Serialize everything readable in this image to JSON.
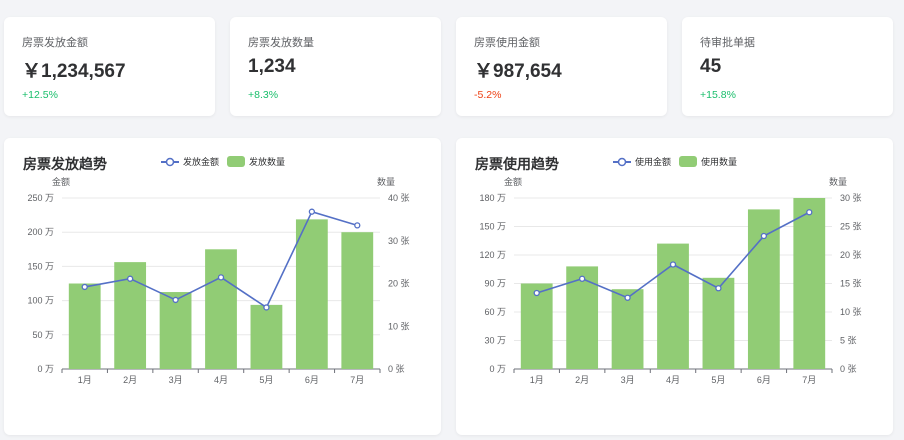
{
  "stats": [
    {
      "label": "房票发放金额",
      "value": "￥1,234,567",
      "change": "+12.5%",
      "change_color": "#19be6b"
    },
    {
      "label": "房票发放数量",
      "value": "1,234",
      "change": "+8.3%",
      "change_color": "#19be6b"
    },
    {
      "label": "房票使用金额",
      "value": "￥987,654",
      "change": "-5.2%",
      "change_color": "#ed4014"
    },
    {
      "label": "待审批单据",
      "value": "45",
      "change": "+15.8%",
      "change_color": "#19be6b"
    }
  ],
  "colors": {
    "bar": "#91cc75",
    "line": "#5470c6"
  },
  "chart_data": [
    {
      "type": "bar",
      "title": "房票发放趋势",
      "categories": [
        "1月",
        "2月",
        "3月",
        "4月",
        "5月",
        "6月",
        "7月"
      ],
      "series": [
        {
          "name": "发放金额",
          "type": "line",
          "axis": "left",
          "values": [
            120,
            132,
            101,
            134,
            90,
            230,
            210
          ]
        },
        {
          "name": "发放数量",
          "type": "bar",
          "axis": "right",
          "values": [
            20,
            25,
            18,
            28,
            15,
            35,
            32
          ]
        }
      ],
      "ylabel_left": "金额",
      "ylabel_right": "数量",
      "ylim_left": [
        0,
        250
      ],
      "ylim_right": [
        0,
        40
      ],
      "yticks_left": [
        "0 万",
        "50 万",
        "100 万",
        "150 万",
        "200 万",
        "250 万"
      ],
      "yticks_right": [
        "0 张",
        "10 张",
        "20 张",
        "30 张",
        "40 张"
      ]
    },
    {
      "type": "bar",
      "title": "房票使用趋势",
      "categories": [
        "1月",
        "2月",
        "3月",
        "4月",
        "5月",
        "6月",
        "7月"
      ],
      "series": [
        {
          "name": "使用金额",
          "type": "line",
          "axis": "left",
          "values": [
            80,
            95,
            75,
            110,
            85,
            140,
            165
          ]
        },
        {
          "name": "使用数量",
          "type": "bar",
          "axis": "right",
          "values": [
            15,
            18,
            14,
            22,
            16,
            28,
            30
          ]
        }
      ],
      "ylabel_left": "金额",
      "ylabel_right": "数量",
      "ylim_left": [
        0,
        180
      ],
      "ylim_right": [
        0,
        30
      ],
      "yticks_left": [
        "0 万",
        "30 万",
        "60 万",
        "90 万",
        "120 万",
        "150 万",
        "180 万"
      ],
      "yticks_right": [
        "0 张",
        "5 张",
        "10 张",
        "15 张",
        "20 张",
        "25 张",
        "30 张"
      ]
    }
  ]
}
